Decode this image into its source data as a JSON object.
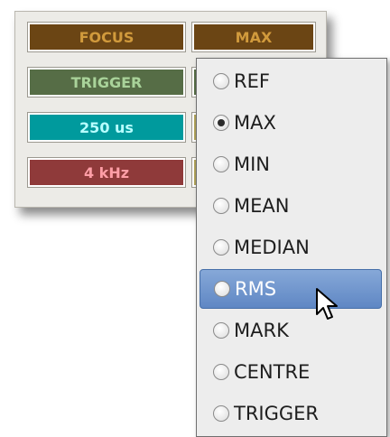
{
  "buttons": [
    {
      "label": "FOCUS",
      "bg": "#6b4514",
      "fg": "#d19a3c"
    },
    {
      "label": "MAX",
      "bg": "#6b4514",
      "fg": "#d19a3c"
    },
    {
      "label": "TRIGGER",
      "bg": "#566d46",
      "fg": "#a9d39a"
    },
    {
      "label": "",
      "bg": "#566d46",
      "fg": "#a9d39a"
    },
    {
      "label": "250 us",
      "bg": "#009a9d",
      "fg": "#b8ffff"
    },
    {
      "label": "",
      "bg": "#b3a55a",
      "fg": "#fff2a8"
    },
    {
      "label": "4 kHz",
      "bg": "#8f3a3a",
      "fg": "#ff9ea6"
    },
    {
      "label": "",
      "bg": "#b3a55a",
      "fg": "#fff2a8"
    }
  ],
  "menu": {
    "items": [
      {
        "label": "REF",
        "checked": false,
        "highlighted": false
      },
      {
        "label": "MAX",
        "checked": true,
        "highlighted": false
      },
      {
        "label": "MIN",
        "checked": false,
        "highlighted": false
      },
      {
        "label": "MEAN",
        "checked": false,
        "highlighted": false
      },
      {
        "label": "MEDIAN",
        "checked": false,
        "highlighted": false
      },
      {
        "label": "RMS",
        "checked": false,
        "highlighted": true
      },
      {
        "label": "MARK",
        "checked": false,
        "highlighted": false
      },
      {
        "label": "CENTRE",
        "checked": false,
        "highlighted": false
      },
      {
        "label": "TRIGGER",
        "checked": false,
        "highlighted": false
      }
    ]
  },
  "icons": {
    "cursor": "mouse-pointer-icon"
  },
  "colors": {
    "highlight": "#6f95cf",
    "panel": "#ecebe7",
    "menu": "#ededed"
  }
}
